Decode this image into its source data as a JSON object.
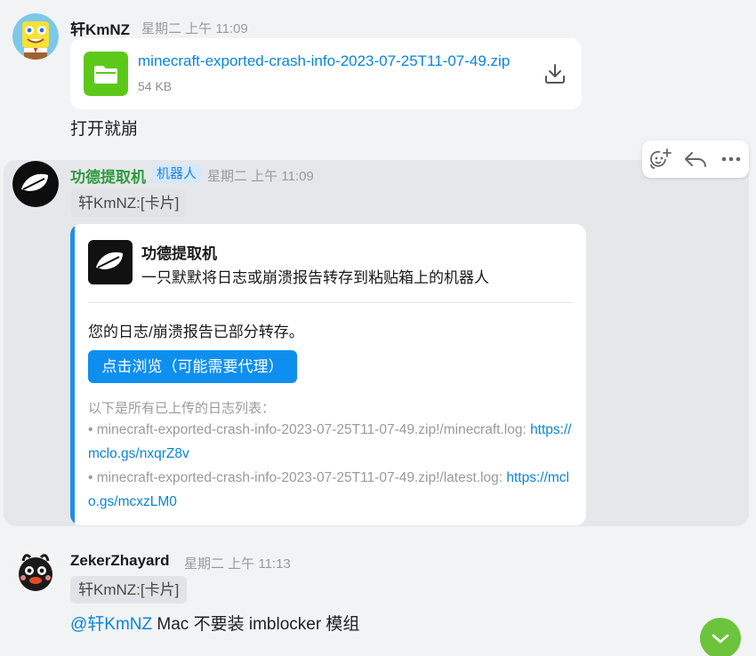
{
  "messages": [
    {
      "sender": "轩KmNZ",
      "time": "星期二 上午 11:09",
      "file": {
        "name": "minecraft-exported-crash-info-2023-07-25T11-07-49.zip",
        "size": "54 KB"
      },
      "text": "打开就崩"
    },
    {
      "sender": "功德提取机",
      "badge": "机器人",
      "time": "星期二 上午 11:09",
      "quote": "轩KmNZ:[卡片]",
      "card": {
        "title": "功德提取机",
        "subtitle": "一只默默将日志或崩溃报告转存到粘贴箱上的机器人",
        "body": "您的日志/崩溃报告已部分转存。",
        "button": "点击浏览（可能需要代理）",
        "note": "以下是所有已上传的日志列表：",
        "logs": [
          {
            "prefix": "• minecraft-exported-crash-info-2023-07-25T11-07-49.zip!/minecraft.log: ",
            "url": "https://mclo.gs/nxqrZ8v"
          },
          {
            "prefix": "• minecraft-exported-crash-info-2023-07-25T11-07-49.zip!/latest.log: ",
            "url": "https://mclo.gs/mcxzLM0"
          }
        ]
      }
    },
    {
      "sender": "ZekerZhayard",
      "time": "星期二 上午 11:13",
      "quote": "轩KmNZ:[卡片]",
      "mention": "@轩KmNZ",
      "text": " Mac 不要装 imblocker 模组"
    }
  ],
  "toolbar": {
    "icons": [
      "add-reaction-icon",
      "reply-icon",
      "more-icon"
    ]
  },
  "colors": {
    "link": "#0a85d8",
    "file_icon": "#5cc91a",
    "bot_name": "#2e9a3e",
    "card_accent": "#1b8ef0",
    "fab": "#6cc43c"
  }
}
